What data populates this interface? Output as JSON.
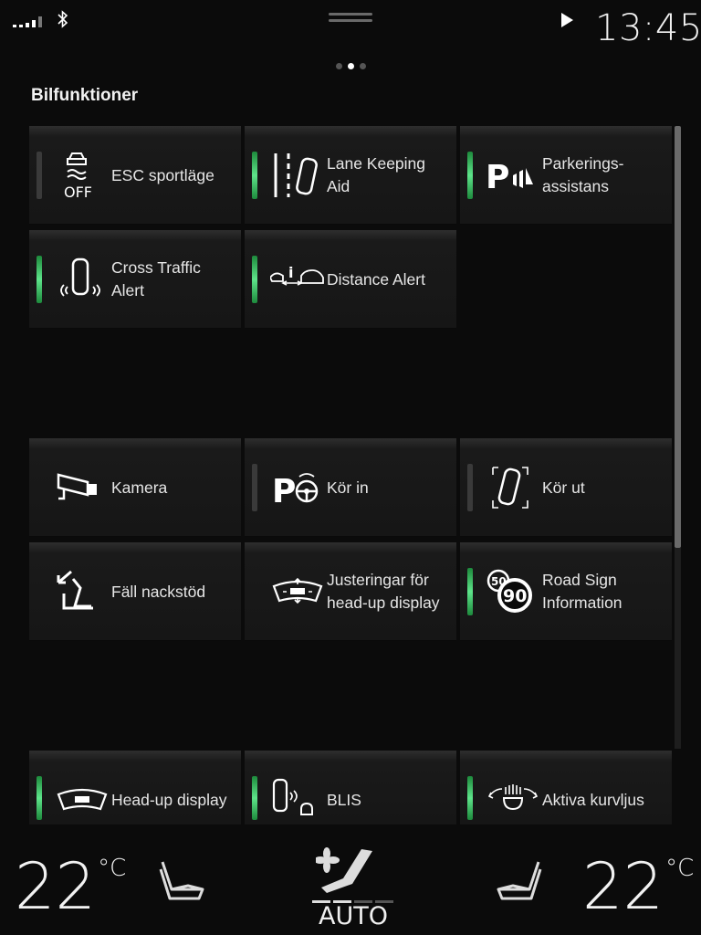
{
  "status": {
    "time": "13:45"
  },
  "page": {
    "title": "Bilfunktioner"
  },
  "tiles": [
    {
      "label": "ESC sportläge",
      "icon": "esc-off-icon",
      "active": false
    },
    {
      "label": "Lane Keeping\nAid",
      "icon": "lane-keeping-icon",
      "active": true
    },
    {
      "label": "Parkerings-\nassistans",
      "icon": "parking-assist-icon",
      "active": true
    },
    {
      "label": "Cross Traffic\nAlert",
      "icon": "cross-traffic-icon",
      "active": true
    },
    {
      "label": "Distance Alert",
      "icon": "distance-alert-icon",
      "active": true
    },
    {
      "label": "Kamera",
      "icon": "camera-icon"
    },
    {
      "label": "Kör in",
      "icon": "park-in-icon",
      "active": false
    },
    {
      "label": "Kör ut",
      "icon": "park-out-icon",
      "active": false
    },
    {
      "label": "Fäll nackstöd",
      "icon": "fold-headrest-icon"
    },
    {
      "label": "Justeringar för\nhead-up display",
      "icon": "hud-adjust-icon"
    },
    {
      "label": "Road Sign\nInformation",
      "icon": "road-sign-icon",
      "active": true
    },
    {
      "label": "Head-up display",
      "icon": "head-up-display-icon",
      "active": true
    },
    {
      "label": "BLIS",
      "icon": "blis-icon",
      "active": true
    },
    {
      "label": "Aktiva kurvljus",
      "icon": "active-bending-light-icon",
      "active": true
    }
  ],
  "climate": {
    "left_temp": "22",
    "right_temp": "22",
    "unit": "°C",
    "mode": "AUTO",
    "fan_level": 2,
    "fan_max": 4
  },
  "colors": {
    "active_indicator": "#5ee48a",
    "inactive_indicator": "#3a3a3a",
    "background": "#0b0b0b"
  }
}
